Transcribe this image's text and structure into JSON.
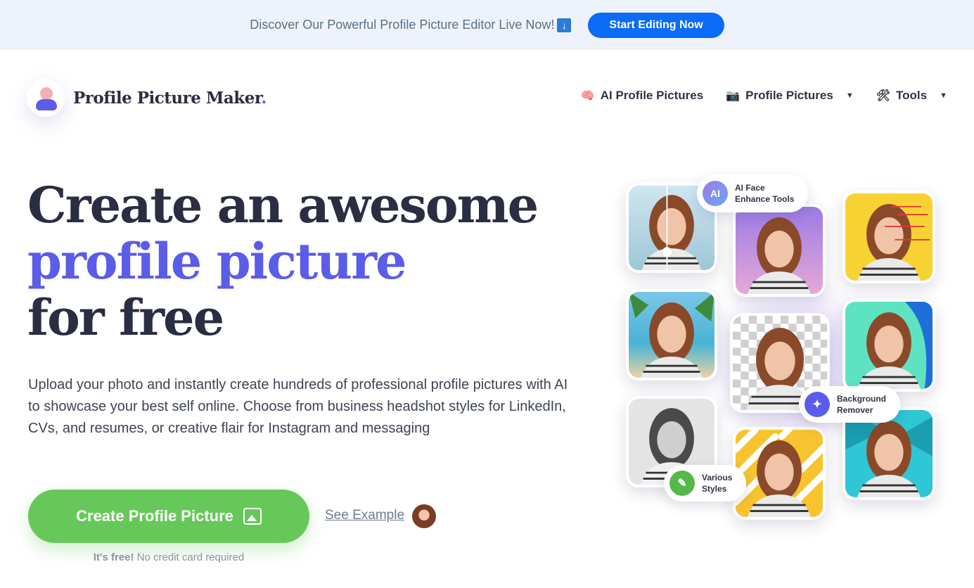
{
  "announcement": {
    "text": "Discover Our Powerful Profile Picture Editor Live Now!",
    "arrow": "↓",
    "button_label": "Start Editing Now"
  },
  "header": {
    "logo_text": "Profile Picture Maker",
    "logo_dot": ".",
    "nav": [
      {
        "icon": "brain-icon",
        "glyph": "🧠",
        "label": "AI Profile Pictures",
        "has_caret": false
      },
      {
        "icon": "camera-icon",
        "glyph": "📷",
        "label": "Profile Pictures",
        "has_caret": true
      },
      {
        "icon": "tools-icon",
        "glyph": "🛠",
        "label": "Tools",
        "has_caret": true
      }
    ]
  },
  "hero": {
    "title_line1": "Create an awesome",
    "title_line2": "profile picture",
    "title_line3": "for free",
    "description": "Upload your photo and instantly create hundreds of professional profile pictures with AI to showcase your best self online. Choose from business headshot styles for LinkedIn, CVs, and resumes, or creative flair for Instagram and messaging",
    "cta_label": "Create Profile Picture",
    "see_example": "See Example",
    "free_bold": "It's free!",
    "free_rest": " No credit card required"
  },
  "collage": {
    "badges": {
      "ai": {
        "icon_text": "AI",
        "label": "AI Face\nEnhance Tools"
      },
      "bg": {
        "icon": "magic-wand-icon",
        "label": "Background\nRemover"
      },
      "styles": {
        "icon": "brush-icon",
        "label": "Various\nStyles"
      }
    }
  },
  "colors": {
    "accent": "#5b5ce8",
    "cta_green": "#67c85a",
    "announce_button": "#0b6cf7",
    "announce_bg": "#eef3fb"
  }
}
